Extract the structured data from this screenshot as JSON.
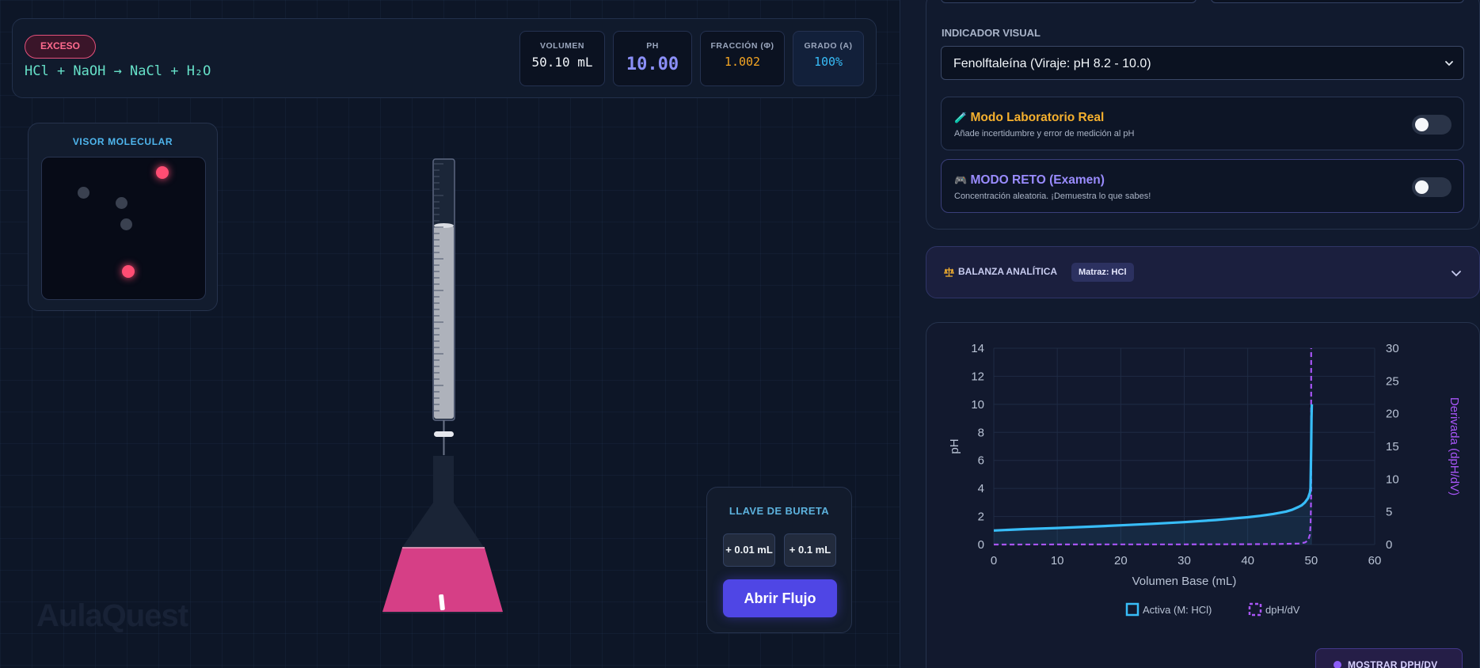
{
  "header": {
    "status_badge": "EXCESO",
    "equation": "HCl + NaOH → NaCl + H₂O",
    "stats": [
      {
        "label": "VOLUMEN",
        "value": "50.10 mL",
        "color": "#f1f5f9"
      },
      {
        "label": "PH",
        "value": "10.00",
        "color": "#8b8ff8"
      },
      {
        "label": "FRACCIÓN (Φ)",
        "value": "1.002",
        "color": "#f5a623"
      },
      {
        "label": "GRADO (Α)",
        "value": "100%",
        "color": "#38bdf8"
      }
    ]
  },
  "visor": {
    "title": "VISOR MOLECULAR",
    "particles": [
      {
        "color": "#ff4d73",
        "glow": true
      },
      {
        "color": "#3a4150",
        "glow": false
      },
      {
        "color": "#3a4150",
        "glow": false
      },
      {
        "color": "#3a4150",
        "glow": false
      },
      {
        "color": "#ff4d73",
        "glow": true
      }
    ]
  },
  "apparatus": {
    "solution_color": "#d63f86",
    "watermark": "AulaQuest"
  },
  "llave": {
    "title": "LLAVE DE BURETA",
    "increment_small": "+ 0.01 mL",
    "increment_large": "+ 0.1 mL",
    "open_flow": "Abrir Flujo"
  },
  "settings": {
    "indicator_label": "INDICADOR VISUAL",
    "indicator_value": "Fenolftaleína (Viraje: pH 8.2 - 10.0)",
    "lab_mode": {
      "icon": "test-tube-icon",
      "title": "Modo Laboratorio Real",
      "subtitle": "Añade incertidumbre y error de medición al pH",
      "enabled": false,
      "color": "#f5b02e"
    },
    "challenge_mode": {
      "icon": "gamepad-icon",
      "title": "MODO RETO (Examen)",
      "subtitle": "Concentración aleatoria. ¡Demuestra lo que sabes!",
      "enabled": false,
      "color": "#9a8cff"
    }
  },
  "balanza": {
    "title": "BALANZA ANALÍTICA",
    "matraz": "Matraz: HCl"
  },
  "chart_data": {
    "type": "line",
    "xlabel": "Volumen Base (mL)",
    "ylabel": "pH",
    "y2label": "Derivada (dpH/dV)",
    "xlim": [
      0,
      60
    ],
    "ylim": [
      0,
      14
    ],
    "y2lim": [
      0,
      30
    ],
    "xticks": [
      0,
      10,
      20,
      30,
      40,
      50,
      60
    ],
    "yticks": [
      0,
      2,
      4,
      6,
      8,
      10,
      12,
      14
    ],
    "y2ticks": [
      0,
      5,
      10,
      15,
      20,
      25,
      30
    ],
    "grid": true,
    "legend_placement": "bottom",
    "series": [
      {
        "name": "Activa (M: HCl)",
        "axis": "left",
        "color": "#38bdf8",
        "style": "solid",
        "x": [
          0,
          5,
          10,
          15,
          20,
          25,
          30,
          35,
          40,
          42,
          44,
          46,
          47,
          48,
          48.5,
          49,
          49.5,
          49.8,
          49.9,
          50.0,
          50.05,
          50.1
        ],
        "y": [
          1.0,
          1.1,
          1.18,
          1.27,
          1.37,
          1.48,
          1.6,
          1.75,
          1.95,
          2.05,
          2.18,
          2.35,
          2.48,
          2.68,
          2.8,
          3.0,
          3.3,
          3.7,
          4.0,
          7.0,
          9.0,
          10.0
        ]
      },
      {
        "name": "dpH/dV",
        "axis": "right",
        "color": "#a855f7",
        "style": "dashed",
        "x": [
          0,
          10,
          20,
          30,
          40,
          45,
          48,
          49,
          49.5,
          49.8,
          49.9,
          49.95,
          50.0,
          50.0
        ],
        "y": [
          0,
          0.01,
          0.02,
          0.03,
          0.05,
          0.08,
          0.15,
          0.3,
          0.6,
          1.5,
          3.0,
          5.0,
          8.0,
          30.0
        ]
      }
    ]
  },
  "deriv_toggle": {
    "label": "MOSTRAR DPH/DV"
  }
}
